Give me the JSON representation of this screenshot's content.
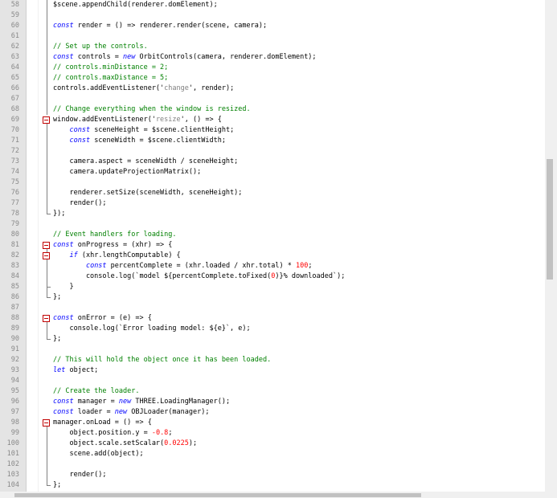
{
  "editor": {
    "lines": [
      {
        "n": "58",
        "code": "$scene.appendChild(renderer.domElement);"
      },
      {
        "n": "59",
        "code": ""
      },
      {
        "n": "60",
        "code": "const render = () => renderer.render(scene, camera);"
      },
      {
        "n": "61",
        "code": ""
      },
      {
        "n": "62",
        "code": "// Set up the controls."
      },
      {
        "n": "63",
        "code": "const controls = new OrbitControls(camera, renderer.domElement);"
      },
      {
        "n": "64",
        "code": "// controls.minDistance = 2;"
      },
      {
        "n": "65",
        "code": "// controls.maxDistance = 5;"
      },
      {
        "n": "66",
        "code": "controls.addEventListener('change', render);"
      },
      {
        "n": "67",
        "code": ""
      },
      {
        "n": "68",
        "code": "// Change everything when the window is resized."
      },
      {
        "n": "69",
        "code": "window.addEventListener('resize', () => {"
      },
      {
        "n": "70",
        "code": "    const sceneHeight = $scene.clientHeight;"
      },
      {
        "n": "71",
        "code": "    const sceneWidth = $scene.clientWidth;"
      },
      {
        "n": "72",
        "code": ""
      },
      {
        "n": "73",
        "code": "    camera.aspect = sceneWidth / sceneHeight;"
      },
      {
        "n": "74",
        "code": "    camera.updateProjectionMatrix();"
      },
      {
        "n": "75",
        "code": ""
      },
      {
        "n": "76",
        "code": "    renderer.setSize(sceneWidth, sceneHeight);"
      },
      {
        "n": "77",
        "code": "    render();"
      },
      {
        "n": "78",
        "code": "});"
      },
      {
        "n": "79",
        "code": ""
      },
      {
        "n": "80",
        "code": "// Event handlers for loading."
      },
      {
        "n": "81",
        "code": "const onProgress = (xhr) => {"
      },
      {
        "n": "82",
        "code": "    if (xhr.lengthComputable) {"
      },
      {
        "n": "83",
        "code": "        const percentComplete = (xhr.loaded / xhr.total) * 100;"
      },
      {
        "n": "84",
        "code": "        console.log(`model ${percentComplete.toFixed(0)}% downloaded`);"
      },
      {
        "n": "85",
        "code": "    }"
      },
      {
        "n": "86",
        "code": "};"
      },
      {
        "n": "87",
        "code": ""
      },
      {
        "n": "88",
        "code": "const onError = (e) => {"
      },
      {
        "n": "89",
        "code": "    console.log(`Error loading model: ${e}`, e);"
      },
      {
        "n": "90",
        "code": "};"
      },
      {
        "n": "91",
        "code": ""
      },
      {
        "n": "92",
        "code": "// This will hold the object once it has been loaded."
      },
      {
        "n": "93",
        "code": "let object;"
      },
      {
        "n": "94",
        "code": ""
      },
      {
        "n": "95",
        "code": "// Create the loader."
      },
      {
        "n": "96",
        "code": "const manager = new THREE.LoadingManager();"
      },
      {
        "n": "97",
        "code": "const loader = new OBJLoader(manager);"
      },
      {
        "n": "98",
        "code": "manager.onLoad = () => {"
      },
      {
        "n": "99",
        "code": "    object.position.y = -0.8;"
      },
      {
        "n": "100",
        "code": "    object.scale.setScalar(0.0225);"
      },
      {
        "n": "101",
        "code": "    scene.add(object);"
      },
      {
        "n": "102",
        "code": ""
      },
      {
        "n": "103",
        "code": "    render();"
      },
      {
        "n": "104",
        "code": "};"
      }
    ],
    "colors": {
      "keyword": "#0000ff",
      "comment": "#008000",
      "string": "#808080",
      "number": "#ff0000",
      "fold_marker": "#c00000",
      "gutter": "#e4e4e4"
    }
  }
}
